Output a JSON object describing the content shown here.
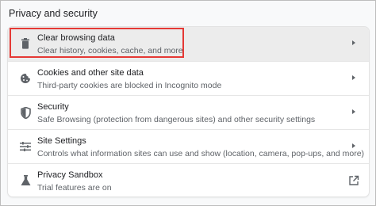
{
  "section": {
    "title": "Privacy and security"
  },
  "rows": [
    {
      "label": "Clear browsing data",
      "sub": "Clear history, cookies, cache, and more",
      "icon": "trash-icon"
    },
    {
      "label": "Cookies and other site data",
      "sub": "Third-party cookies are blocked in Incognito mode",
      "icon": "cookie-icon"
    },
    {
      "label": "Security",
      "sub": "Safe Browsing (protection from dangerous sites) and other security settings",
      "icon": "shield-icon"
    },
    {
      "label": "Site Settings",
      "sub": "Controls what information sites can use and show (location, camera, pop-ups, and more)",
      "icon": "sliders-icon"
    },
    {
      "label": "Privacy Sandbox",
      "sub": "Trial features are on",
      "icon": "flask-icon"
    }
  ],
  "colors": {
    "highlight_border": "#e53935",
    "accent_text": "#202124",
    "secondary_text": "#5f6368"
  }
}
